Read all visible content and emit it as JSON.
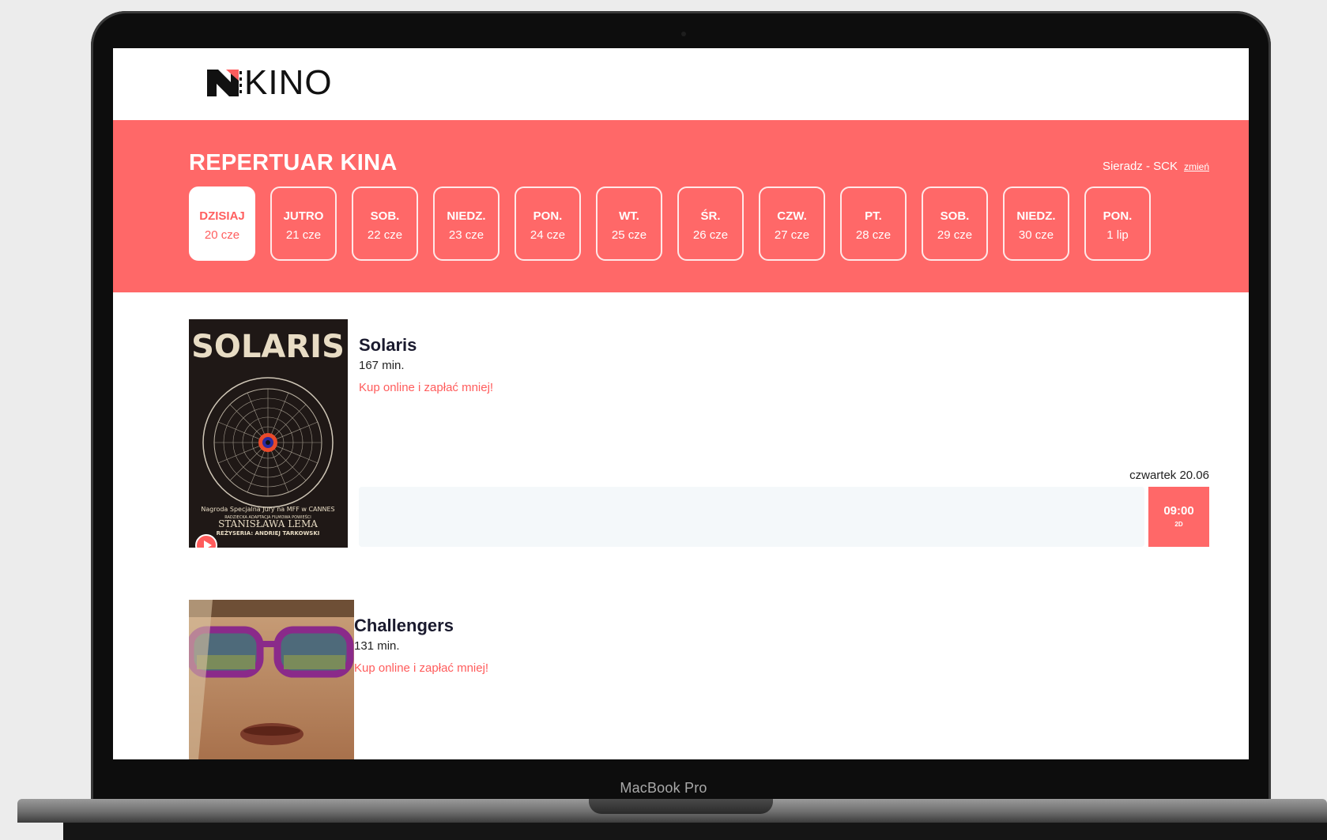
{
  "device": {
    "label": "MacBook Pro"
  },
  "header": {
    "logo_text": "KINO"
  },
  "repertoire": {
    "title": "REPERTUAR KINA",
    "location": "Sieradz - SCK",
    "change_label": "zmień",
    "dates": [
      {
        "day": "DZISIAJ",
        "date": "20 cze",
        "active": true
      },
      {
        "day": "JUTRO",
        "date": "21 cze"
      },
      {
        "day": "SOB.",
        "date": "22 cze"
      },
      {
        "day": "NIEDZ.",
        "date": "23 cze"
      },
      {
        "day": "PON.",
        "date": "24 cze"
      },
      {
        "day": "WT.",
        "date": "25 cze"
      },
      {
        "day": "ŚR.",
        "date": "26 cze"
      },
      {
        "day": "CZW.",
        "date": "27 cze"
      },
      {
        "day": "PT.",
        "date": "28 cze"
      },
      {
        "day": "SOB.",
        "date": "29 cze"
      },
      {
        "day": "NIEDZ.",
        "date": "30 cze"
      },
      {
        "day": "PON.",
        "date": "1 lip"
      }
    ]
  },
  "movies": [
    {
      "title": "Solaris",
      "duration": "167 min.",
      "buy_label": "Kup online i zapłać mniej!",
      "poster": {
        "title_art": "SOLARIS",
        "caption_1": "Nagroda Specjalna Jury na MFF w CANNES",
        "caption_2": "RADZIECKA ADAPTACJA FILMOWA POWIEŚCI",
        "caption_3": "STANISŁAWA LEMA",
        "caption_4": "REŻYSERIA: ANDRIEJ TARKOWSKI"
      },
      "weekday_label": "czwartek 20.06",
      "showtimes": [
        {
          "time": "09:00",
          "format": "2D"
        }
      ]
    },
    {
      "title": "Challengers",
      "duration": "131 min.",
      "buy_label": "Kup online i zapłać mniej!"
    }
  ],
  "colors": {
    "accent": "#ff6868",
    "link": "#ff5c5c",
    "title": "#1a1a2e"
  }
}
